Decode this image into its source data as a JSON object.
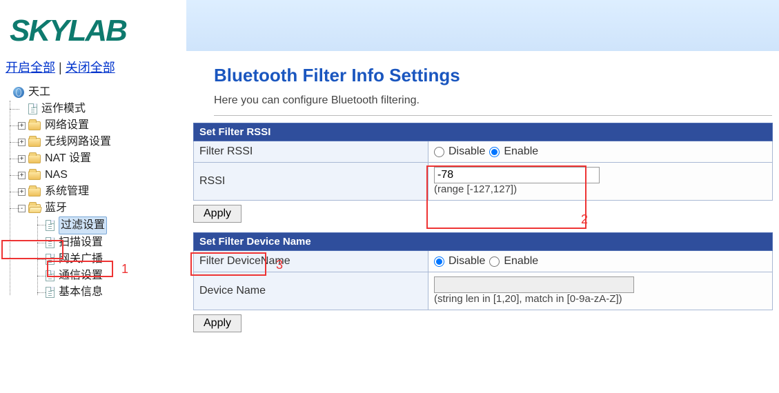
{
  "brand": "SKYLAB",
  "treeControls": {
    "openAll": "开启全部",
    "closeAll": "关闭全部"
  },
  "tree": {
    "root": "天工",
    "items": [
      {
        "label": "运作模式",
        "icon": "page"
      },
      {
        "label": "网络设置",
        "icon": "folder",
        "exp": "+"
      },
      {
        "label": "无线网路设置",
        "icon": "folder",
        "exp": "+"
      },
      {
        "label": "NAT 设置",
        "icon": "folder",
        "exp": "+"
      },
      {
        "label": "NAS",
        "icon": "folder",
        "exp": "+"
      },
      {
        "label": "系统管理",
        "icon": "folder",
        "exp": "+"
      },
      {
        "label": "蓝牙",
        "icon": "folder",
        "exp": "-",
        "children": [
          {
            "label": "过滤设置",
            "selected": true
          },
          {
            "label": "扫描设置"
          },
          {
            "label": "网关广播"
          },
          {
            "label": "通信设置"
          },
          {
            "label": "基本信息"
          }
        ]
      }
    ]
  },
  "annotations": {
    "one": "1",
    "two": "2",
    "three": "3"
  },
  "page": {
    "title": "Bluetooth Filter Info Settings",
    "subtitle": "Here you can configure Bluetooth filtering."
  },
  "rssiSection": {
    "header": "Set Filter RSSI",
    "row1Label": "Filter RSSI",
    "disable": "Disable",
    "enable": "Enable",
    "row2Label": "RSSI",
    "value": "-78",
    "hint": "(range [-127,127])",
    "apply": "Apply"
  },
  "nameSection": {
    "header": "Set Filter Device Name",
    "row1Label": "Filter DeviceName",
    "disable": "Disable",
    "enable": "Enable",
    "row2Label": "Device Name",
    "value": "",
    "hint": "(string len in [1,20], match in [0-9a-zA-Z])",
    "apply": "Apply"
  }
}
